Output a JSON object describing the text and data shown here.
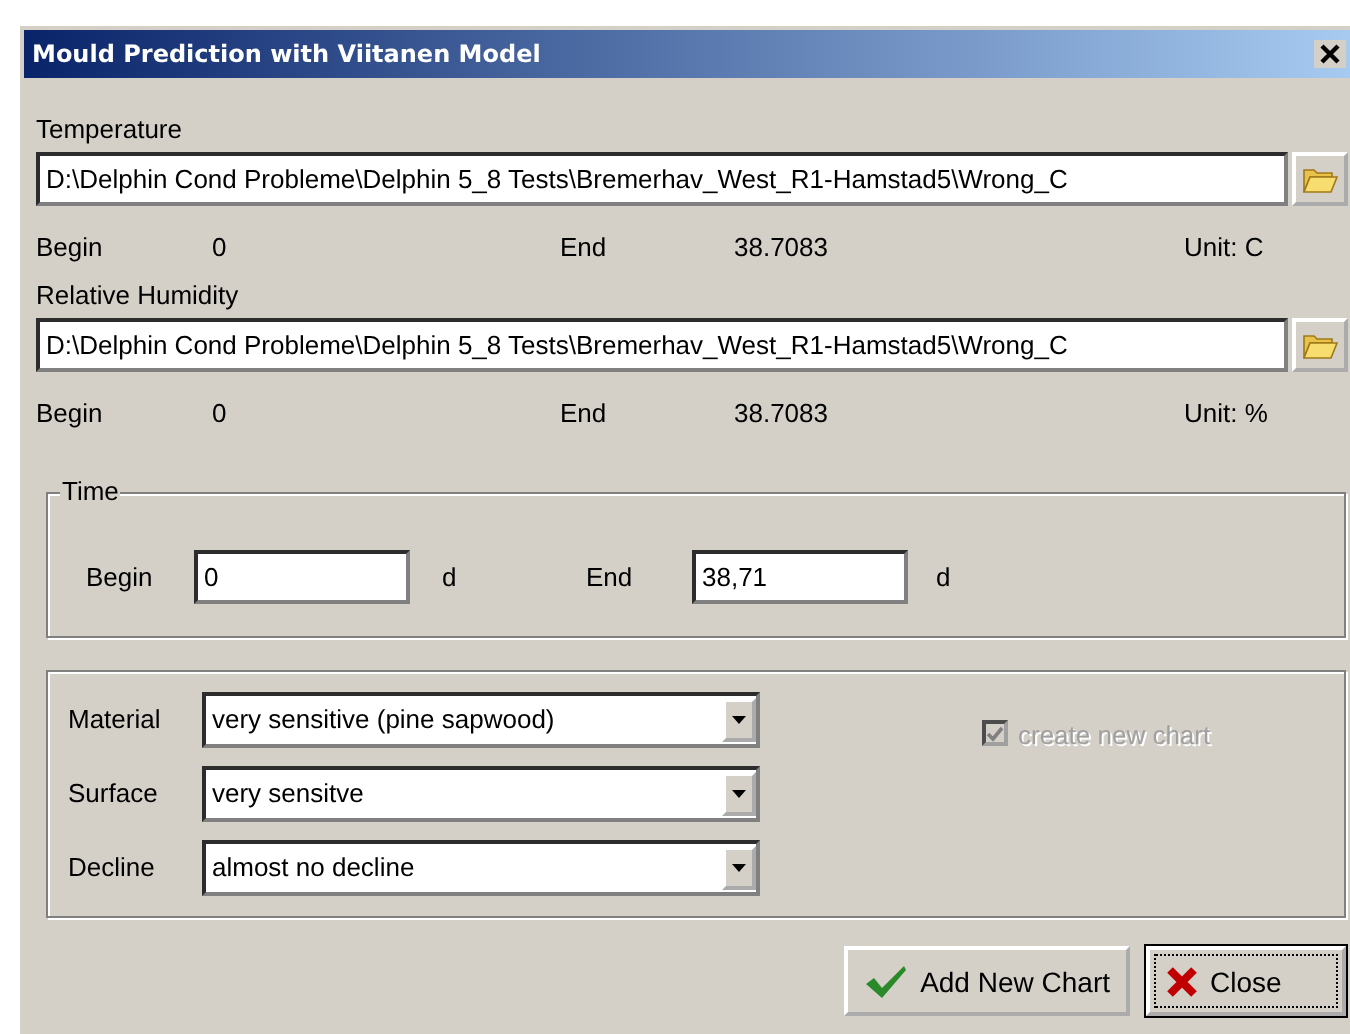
{
  "window": {
    "title": "Mould Prediction with Viitanen Model"
  },
  "sources": [
    {
      "label": "Temperature",
      "path": "D:\\Delphin Cond Probleme\\Delphin 5_8 Tests\\Bremerhav_West_R1-Hamstad5\\Wrong_C",
      "begin_label": "Begin",
      "begin": "0",
      "end_label": "End",
      "end": "38.7083",
      "unit": "Unit: C"
    },
    {
      "label": "Relative Humidity",
      "path": "D:\\Delphin Cond Probleme\\Delphin 5_8 Tests\\Bremerhav_West_R1-Hamstad5\\Wrong_C",
      "begin_label": "Begin",
      "begin": "0",
      "end_label": "End",
      "end": "38.7083",
      "unit": "Unit: %"
    }
  ],
  "time": {
    "title": "Time",
    "begin_label": "Begin",
    "begin_value": "0",
    "begin_unit": "d",
    "end_label": "End",
    "end_value": "38,71",
    "end_unit": "d"
  },
  "options": [
    {
      "label": "Material",
      "value": "very sensitive (pine sapwood)"
    },
    {
      "label": "Surface",
      "value": "very sensitve"
    },
    {
      "label": "Decline",
      "value": "almost no decline"
    }
  ],
  "create_chart": {
    "label": "create new chart",
    "checked": true,
    "disabled": true
  },
  "buttons": [
    {
      "label": "Add New Chart",
      "kind": "add",
      "focused": false
    },
    {
      "label": "Close",
      "kind": "close",
      "focused": true
    }
  ]
}
